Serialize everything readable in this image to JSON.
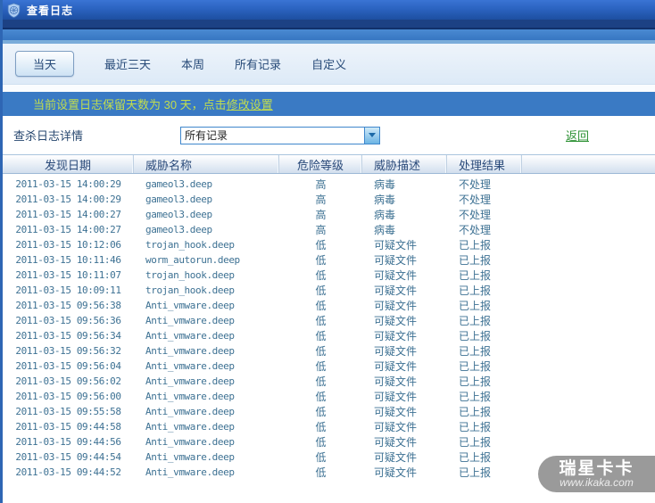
{
  "window": {
    "title": "查看日志"
  },
  "tabs": {
    "items": [
      {
        "label": "当天",
        "selected": true
      },
      {
        "label": "最近三天",
        "selected": false
      },
      {
        "label": "本周",
        "selected": false
      },
      {
        "label": "所有记录",
        "selected": false
      },
      {
        "label": "自定义",
        "selected": false
      }
    ]
  },
  "notice": {
    "prefix": "当前设置日志保留天数为 30 天，点击",
    "link": "修改设置",
    "retention_days": "30"
  },
  "filter": {
    "label": "查杀日志详情",
    "selected_option": "所有记录",
    "back_link": "返回"
  },
  "table": {
    "headers": [
      "发现日期",
      "威胁名称",
      "危险等级",
      "威胁描述",
      "处理结果"
    ],
    "rows": [
      {
        "date": "2011-03-15 14:00:29",
        "name": "gameol3.deep",
        "level": "高",
        "desc": "病毒",
        "result": "不处理"
      },
      {
        "date": "2011-03-15 14:00:29",
        "name": "gameol3.deep",
        "level": "高",
        "desc": "病毒",
        "result": "不处理"
      },
      {
        "date": "2011-03-15 14:00:27",
        "name": "gameol3.deep",
        "level": "高",
        "desc": "病毒",
        "result": "不处理"
      },
      {
        "date": "2011-03-15 14:00:27",
        "name": "gameol3.deep",
        "level": "高",
        "desc": "病毒",
        "result": "不处理"
      },
      {
        "date": "2011-03-15 10:12:06",
        "name": "trojan_hook.deep",
        "level": "低",
        "desc": "可疑文件",
        "result": "已上报"
      },
      {
        "date": "2011-03-15 10:11:46",
        "name": "worm_autorun.deep",
        "level": "低",
        "desc": "可疑文件",
        "result": "已上报"
      },
      {
        "date": "2011-03-15 10:11:07",
        "name": "trojan_hook.deep",
        "level": "低",
        "desc": "可疑文件",
        "result": "已上报"
      },
      {
        "date": "2011-03-15 10:09:11",
        "name": "trojan_hook.deep",
        "level": "低",
        "desc": "可疑文件",
        "result": "已上报"
      },
      {
        "date": "2011-03-15 09:56:38",
        "name": "Anti_vmware.deep",
        "level": "低",
        "desc": "可疑文件",
        "result": "已上报"
      },
      {
        "date": "2011-03-15 09:56:36",
        "name": "Anti_vmware.deep",
        "level": "低",
        "desc": "可疑文件",
        "result": "已上报"
      },
      {
        "date": "2011-03-15 09:56:34",
        "name": "Anti_vmware.deep",
        "level": "低",
        "desc": "可疑文件",
        "result": "已上报"
      },
      {
        "date": "2011-03-15 09:56:32",
        "name": "Anti_vmware.deep",
        "level": "低",
        "desc": "可疑文件",
        "result": "已上报"
      },
      {
        "date": "2011-03-15 09:56:04",
        "name": "Anti_vmware.deep",
        "level": "低",
        "desc": "可疑文件",
        "result": "已上报"
      },
      {
        "date": "2011-03-15 09:56:02",
        "name": "Anti_vmware.deep",
        "level": "低",
        "desc": "可疑文件",
        "result": "已上报"
      },
      {
        "date": "2011-03-15 09:56:00",
        "name": "Anti_vmware.deep",
        "level": "低",
        "desc": "可疑文件",
        "result": "已上报"
      },
      {
        "date": "2011-03-15 09:55:58",
        "name": "Anti_vmware.deep",
        "level": "低",
        "desc": "可疑文件",
        "result": "已上报"
      },
      {
        "date": "2011-03-15 09:44:58",
        "name": "Anti_vmware.deep",
        "level": "低",
        "desc": "可疑文件",
        "result": "已上报"
      },
      {
        "date": "2011-03-15 09:44:56",
        "name": "Anti_vmware.deep",
        "level": "低",
        "desc": "可疑文件",
        "result": "已上报"
      },
      {
        "date": "2011-03-15 09:44:54",
        "name": "Anti_vmware.deep",
        "level": "低",
        "desc": "可疑文件",
        "result": "已上报"
      },
      {
        "date": "2011-03-15 09:44:52",
        "name": "Anti_vmware.deep",
        "level": "低",
        "desc": "可疑文件",
        "result": "已上报"
      }
    ]
  },
  "watermark": {
    "brand": "瑞星卡卡",
    "url": "www.ikaka.com"
  },
  "colors": {
    "titlebar_blue": "#2b63c0",
    "notice_bg": "#3a7ac4",
    "notice_text": "#c2dd4e",
    "back_link_green": "#2e9235",
    "row_text": "#3d7193",
    "dropdown_border": "#3f87cc",
    "watermark_grey": "#9a9a9a"
  }
}
